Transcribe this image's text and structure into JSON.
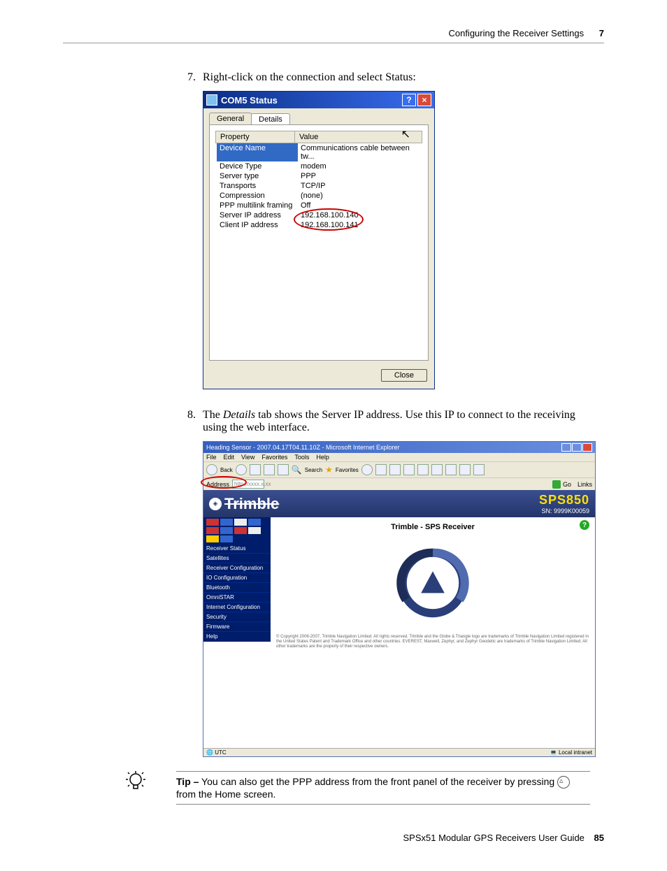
{
  "header": {
    "title": "Configuring the Receiver Settings",
    "chapter": "7"
  },
  "steps": {
    "s7": {
      "num": "7.",
      "text": "Right-click on the connection and select Status:"
    },
    "s8": {
      "num": "8.",
      "text_a": "The ",
      "italic": "Details",
      "text_b": " tab shows the Server IP address. Use this IP to connect to the receiving using the web interface."
    }
  },
  "dialog": {
    "title": "COM5 Status",
    "tabs": {
      "general": "General",
      "details": "Details"
    },
    "head": {
      "property": "Property",
      "value": "Value"
    },
    "rows": [
      {
        "k": "Device Name",
        "v": "Communications cable between tw...",
        "sel": true
      },
      {
        "k": "Device Type",
        "v": "modem"
      },
      {
        "k": "Server type",
        "v": "PPP"
      },
      {
        "k": "Transports",
        "v": "TCP/IP"
      },
      {
        "k": "Compression",
        "v": "(none)"
      },
      {
        "k": "PPP multilink framing",
        "v": "Off"
      },
      {
        "k": "Server IP address",
        "v": "192.168.100.140"
      },
      {
        "k": "Client IP address",
        "v": "192.168.100.141"
      }
    ],
    "close": "Close"
  },
  "browser": {
    "title": "Heading Sensor - 2007.04.17T04.11.10Z - Microsoft Internet Explorer",
    "menu": [
      "File",
      "Edit",
      "View",
      "Favorites",
      "Tools",
      "Help"
    ],
    "toolbar": {
      "back": "Back",
      "search": "Search",
      "favorites": "Favorites"
    },
    "address_label": "Address",
    "address": "http://xxxx.x.xx",
    "go": "Go",
    "links": "Links",
    "logo": "Trimble",
    "model": "SPS850",
    "sn": "SN: 9999K00059",
    "main_title": "Trimble - SPS Receiver",
    "sidebar": [
      "Receiver Status",
      "Satellites",
      "Receiver Configuration",
      "IO Configuration",
      "Bluetooth",
      "OmniSTAR",
      "Internet Configuration",
      "Security",
      "Firmware",
      "Help"
    ],
    "copyright": "© Copyright 2006-2007, Trimble Navigation Limited. All rights reserved. Trimble and the Globe & Triangle logo are trademarks of Trimble Navigation Limited registered in the United States Patent and Trademark Office and other countries. EVEREST, Maxwell, Zephyr, and Zephyr Geodetic are trademarks of Trimble Navigation Limited. All other trademarks are the property of their respective owners.",
    "status_left": "UTC",
    "status_right": "Local intranet"
  },
  "tip": {
    "label": "Tip –",
    "text_a": " You can also get the PPP address from the front panel of the receiver by pressing ",
    "text_b": " from the Home screen."
  },
  "footer": {
    "guide": "SPSx51 Modular GPS Receivers User Guide",
    "page": "85"
  }
}
